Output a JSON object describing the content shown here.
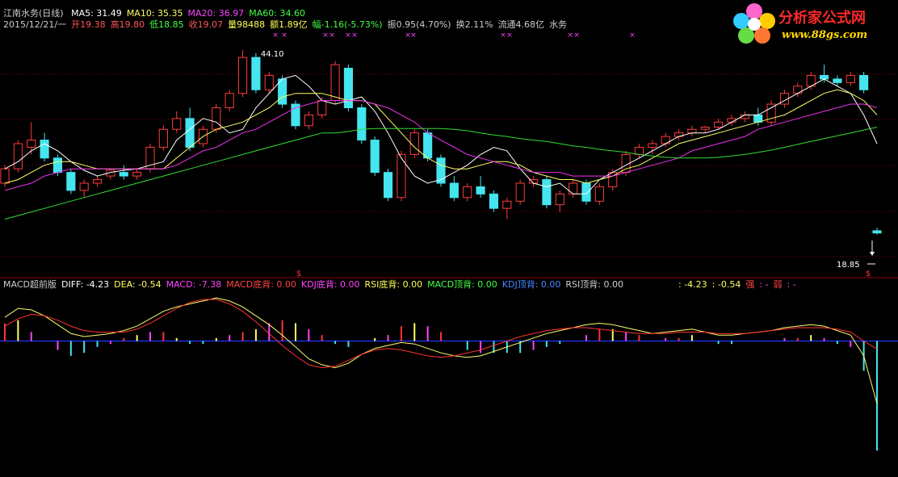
{
  "header": {
    "title": "江南水务(日线)",
    "ma": [
      {
        "label": "MA5: 31.49",
        "color": "#ffffff"
      },
      {
        "label": "MA10: 35.35",
        "color": "#ffff66"
      },
      {
        "label": "MA20: 36.97",
        "color": "#ff44ff"
      },
      {
        "label": "MA60: 34.60",
        "color": "#44ff44"
      }
    ],
    "info_line": [
      {
        "text": "2015/12/21/一",
        "color": "#cccccc"
      },
      {
        "text": "开19.38",
        "color": "#ff5555"
      },
      {
        "text": "高19.80",
        "color": "#ff5555"
      },
      {
        "text": "低18.85",
        "color": "#44ff44"
      },
      {
        "text": "收19.07",
        "color": "#ff5555"
      },
      {
        "text": "量98488",
        "color": "#ffff55"
      },
      {
        "text": "额1.89亿",
        "color": "#ffff55"
      },
      {
        "text": "幅-1.16(-5.73%)",
        "color": "#44ff44"
      },
      {
        "text": "振0.95(4.70%)",
        "color": "#cccccc"
      },
      {
        "text": "换2.11%",
        "color": "#cccccc"
      },
      {
        "text": "流通4.68亿",
        "color": "#cccccc"
      },
      {
        "text": "水务",
        "color": "#cccccc"
      }
    ],
    "macd_line": [
      {
        "text": "MACD超前版",
        "color": "#cccccc"
      },
      {
        "text": "DIFF: -4.23",
        "color": "#ffffff"
      },
      {
        "text": "DEA: -0.54",
        "color": "#ffff66"
      },
      {
        "text": "MACD: -7.38",
        "color": "#ff44ff"
      },
      {
        "text": "MACD底背: 0.00",
        "color": "#ff4444"
      },
      {
        "text": "KDJ底背: 0.00",
        "color": "#ff44ff"
      },
      {
        "text": "RSI底背: 0.00",
        "color": "#ffff55"
      },
      {
        "text": "MACD顶背: 0.00",
        "color": "#44ff44"
      },
      {
        "text": "KDJ顶背: 0.00",
        "color": "#4488ff"
      },
      {
        "text": "RSI顶背: 0.00",
        "color": "#cccccc"
      }
    ],
    "macd_right": [
      {
        "text": ": -4.23",
        "color": "#ffff66"
      },
      {
        "text": ": -0.54",
        "color": "#ffff66"
      },
      {
        "text": "强",
        "color": "#ff4444"
      },
      {
        "text": ": -",
        "color": "#ff44ff"
      },
      {
        "text": "弱",
        "color": "#ff4444"
      },
      {
        "text": ": -",
        "color": "#ff44ff"
      }
    ]
  },
  "logo": {
    "title": "分析家公式网",
    "url": "www.88gs.com"
  },
  "annotations": {
    "high_label": "44.10",
    "low_label": "18.85",
    "signal_label": "$"
  },
  "colors": {
    "up": "#ff3b3b",
    "down": "#44e5ee",
    "ma5": "#ffffff",
    "ma10": "#ffff66",
    "ma20": "#ee33ee",
    "ma60": "#33dd33",
    "diff": "#ffff66",
    "dea": "#ff3333",
    "zero": "#2233ff",
    "grid": "#8b0000",
    "mark": "#ff44ff"
  },
  "chart_data": [
    {
      "type": "candlestick",
      "title": "江南水务(日线)",
      "ylim": [
        17.8,
        47
      ],
      "series": [
        {
          "name": "MA5",
          "values": [
            28,
            29,
            30.5,
            31.5,
            30.5,
            29,
            27.8,
            27,
            27.5,
            27.8,
            28,
            28.5,
            29,
            32,
            33.5,
            35,
            34.5,
            33,
            33.5,
            36.5,
            38.5,
            40.5,
            41,
            39.5,
            37.5,
            37,
            37.5,
            38,
            36,
            33,
            29.5,
            27,
            26,
            26.5,
            27.5,
            28.5,
            30,
            31,
            30.5,
            28,
            26,
            25.5,
            26,
            24.5,
            24.5,
            26.5,
            27.5,
            28.5,
            29.5,
            30.5,
            31.5,
            32.5,
            33,
            33,
            33.5,
            34.5,
            35.5,
            35.5,
            36.5,
            37.5,
            38.5,
            39.5,
            40.5,
            39.5,
            38.5,
            35.5,
            31.5
          ]
        },
        {
          "name": "MA10",
          "values": [
            26,
            26.5,
            27.5,
            28.5,
            29,
            29,
            28.5,
            28,
            28,
            28,
            28,
            28,
            28,
            29.5,
            31,
            32.5,
            33.5,
            34,
            34.5,
            35.5,
            36.5,
            38,
            38.5,
            38.5,
            38.5,
            38,
            37.5,
            37.5,
            37,
            35,
            33,
            31,
            29.5,
            28.5,
            28,
            28,
            28.5,
            29,
            29,
            28.5,
            27.5,
            27,
            26.5,
            26.5,
            26,
            26.5,
            27,
            28,
            28.5,
            29.5,
            30.5,
            31.5,
            32,
            32.5,
            33,
            33.5,
            34,
            34.5,
            35,
            35.5,
            36.5,
            37.5,
            38.5,
            39,
            38.5,
            37.5,
            35.5
          ]
        },
        {
          "name": "MA20",
          "values": [
            25,
            25.5,
            26,
            27,
            27.5,
            28,
            28,
            28,
            28,
            28,
            28,
            28,
            28,
            28.5,
            29.5,
            30.5,
            31,
            32,
            33,
            33.5,
            34.5,
            35.5,
            36.5,
            37,
            37.5,
            37.5,
            37.5,
            37.5,
            37,
            36.5,
            35.5,
            34.5,
            33,
            32,
            31,
            30,
            29.5,
            29,
            28.5,
            28,
            27.5,
            27.5,
            27.5,
            27,
            27,
            27,
            27,
            27.5,
            28,
            28.5,
            29,
            29.5,
            30.5,
            31,
            31.5,
            32,
            32.5,
            33.5,
            34,
            34.5,
            35,
            35.5,
            36,
            36.5,
            37,
            37,
            36.5
          ]
        },
        {
          "name": "MA60",
          "values": [
            21,
            21.5,
            22,
            22.5,
            23,
            23.5,
            24,
            24.5,
            25,
            25.5,
            26,
            26.5,
            27,
            27.5,
            28,
            28.5,
            29,
            29.5,
            30,
            30.5,
            31,
            31.5,
            32,
            32.5,
            33,
            33,
            33.2,
            33.5,
            33.6,
            33.6,
            33.6,
            33.6,
            33.6,
            33.6,
            33.5,
            33.3,
            33,
            32.7,
            32.5,
            32.2,
            32,
            31.8,
            31.5,
            31.2,
            31,
            30.7,
            30.5,
            30.3,
            30,
            29.8,
            29.6,
            29.5,
            29.5,
            29.5,
            29.6,
            29.8,
            30,
            30.3,
            30.6,
            31,
            31.4,
            31.8,
            32.2,
            32.6,
            33,
            33.4,
            33.8
          ]
        }
      ],
      "candles": [
        {
          "o": 26,
          "h": 28.5,
          "l": 25.5,
          "c": 28
        },
        {
          "o": 28,
          "h": 32,
          "l": 27.5,
          "c": 31.5
        },
        {
          "o": 31,
          "h": 34.5,
          "l": 30,
          "c": 32
        },
        {
          "o": 32,
          "h": 33,
          "l": 29,
          "c": 29.5
        },
        {
          "o": 29.5,
          "h": 30,
          "l": 27,
          "c": 27.5
        },
        {
          "o": 27.5,
          "h": 28,
          "l": 24.5,
          "c": 25
        },
        {
          "o": 25,
          "h": 26.5,
          "l": 24,
          "c": 26
        },
        {
          "o": 26,
          "h": 27,
          "l": 25.5,
          "c": 26.5
        },
        {
          "o": 27,
          "h": 28,
          "l": 26.5,
          "c": 27.8
        },
        {
          "o": 27.5,
          "h": 28.5,
          "l": 26.5,
          "c": 27
        },
        {
          "o": 27,
          "h": 28,
          "l": 26.5,
          "c": 27.5
        },
        {
          "o": 28,
          "h": 31.5,
          "l": 27.5,
          "c": 31
        },
        {
          "o": 31,
          "h": 34,
          "l": 30.5,
          "c": 33.5
        },
        {
          "o": 33.5,
          "h": 36,
          "l": 33,
          "c": 35
        },
        {
          "o": 35,
          "h": 36.5,
          "l": 30.5,
          "c": 31
        },
        {
          "o": 31.5,
          "h": 34,
          "l": 31,
          "c": 33.5
        },
        {
          "o": 33.5,
          "h": 37,
          "l": 33,
          "c": 36.5
        },
        {
          "o": 36.5,
          "h": 39,
          "l": 36,
          "c": 38.5
        },
        {
          "o": 38.5,
          "h": 44.5,
          "l": 38,
          "c": 43.5
        },
        {
          "o": 43.5,
          "h": 44.1,
          "l": 38.5,
          "c": 39
        },
        {
          "o": 39,
          "h": 41.5,
          "l": 38.5,
          "c": 41
        },
        {
          "o": 40.5,
          "h": 41,
          "l": 36.5,
          "c": 37
        },
        {
          "o": 37,
          "h": 37.5,
          "l": 33.5,
          "c": 34
        },
        {
          "o": 34,
          "h": 36,
          "l": 33.5,
          "c": 35.5
        },
        {
          "o": 35.5,
          "h": 38,
          "l": 35,
          "c": 37.5
        },
        {
          "o": 37.5,
          "h": 43,
          "l": 37,
          "c": 42.5
        },
        {
          "o": 42,
          "h": 42.5,
          "l": 36,
          "c": 36.5
        },
        {
          "o": 36.5,
          "h": 37,
          "l": 31.5,
          "c": 32
        },
        {
          "o": 32,
          "h": 32.5,
          "l": 27,
          "c": 27.5
        },
        {
          "o": 27.5,
          "h": 28,
          "l": 23.5,
          "c": 24
        },
        {
          "o": 24,
          "h": 30.5,
          "l": 23.5,
          "c": 30
        },
        {
          "o": 30,
          "h": 33.5,
          "l": 29.5,
          "c": 33
        },
        {
          "o": 33,
          "h": 33.5,
          "l": 29,
          "c": 29.5
        },
        {
          "o": 29.5,
          "h": 30,
          "l": 25.5,
          "c": 26
        },
        {
          "o": 26,
          "h": 27,
          "l": 23.5,
          "c": 24
        },
        {
          "o": 24,
          "h": 26,
          "l": 23.5,
          "c": 25.5
        },
        {
          "o": 25.5,
          "h": 27,
          "l": 24,
          "c": 24.5
        },
        {
          "o": 24.5,
          "h": 25,
          "l": 22,
          "c": 22.5
        },
        {
          "o": 22.5,
          "h": 24,
          "l": 21,
          "c": 23.5
        },
        {
          "o": 23.5,
          "h": 26.5,
          "l": 23,
          "c": 26
        },
        {
          "o": 26,
          "h": 27,
          "l": 25.5,
          "c": 26.5
        },
        {
          "o": 26.5,
          "h": 27,
          "l": 22.5,
          "c": 23
        },
        {
          "o": 23,
          "h": 25,
          "l": 22,
          "c": 24.5
        },
        {
          "o": 24.5,
          "h": 26.5,
          "l": 24,
          "c": 26
        },
        {
          "o": 26,
          "h": 26.5,
          "l": 23,
          "c": 23.5
        },
        {
          "o": 23.5,
          "h": 26,
          "l": 23,
          "c": 25.5
        },
        {
          "o": 25.5,
          "h": 28,
          "l": 25,
          "c": 27.5
        },
        {
          "o": 27.5,
          "h": 30.5,
          "l": 27,
          "c": 30
        },
        {
          "o": 30,
          "h": 31.5,
          "l": 29.5,
          "c": 31
        },
        {
          "o": 31,
          "h": 32,
          "l": 30,
          "c": 31.5
        },
        {
          "o": 31.5,
          "h": 33,
          "l": 31,
          "c": 32.5
        },
        {
          "o": 32.5,
          "h": 33.5,
          "l": 32,
          "c": 33
        },
        {
          "o": 33,
          "h": 34,
          "l": 32.5,
          "c": 33.5
        },
        {
          "o": 33.5,
          "h": 34,
          "l": 33,
          "c": 33.8
        },
        {
          "o": 33.8,
          "h": 35,
          "l": 33.5,
          "c": 34.5
        },
        {
          "o": 34.5,
          "h": 35.5,
          "l": 34,
          "c": 35
        },
        {
          "o": 35,
          "h": 36,
          "l": 34.5,
          "c": 35.5
        },
        {
          "o": 35.5,
          "h": 36.5,
          "l": 34,
          "c": 34.5
        },
        {
          "o": 34.5,
          "h": 37.5,
          "l": 34,
          "c": 37
        },
        {
          "o": 37,
          "h": 39,
          "l": 36.5,
          "c": 38.5
        },
        {
          "o": 38.5,
          "h": 40,
          "l": 38,
          "c": 39.5
        },
        {
          "o": 39.5,
          "h": 41.5,
          "l": 39,
          "c": 41
        },
        {
          "o": 41,
          "h": 42.5,
          "l": 40,
          "c": 40.5
        },
        {
          "o": 40.5,
          "h": 41,
          "l": 39.5,
          "c": 40
        },
        {
          "o": 40,
          "h": 41.5,
          "l": 39.5,
          "c": 41
        },
        {
          "o": 41,
          "h": 41.5,
          "l": 38.5,
          "c": 39
        },
        {
          "o": 19.38,
          "h": 19.8,
          "l": 18.85,
          "c": 19.07
        }
      ],
      "high_label": {
        "index": 19,
        "value": 44.1
      },
      "low_label": {
        "index": 66,
        "value": 18.85
      }
    },
    {
      "type": "bar",
      "title": "MACD超前版",
      "ylim": [
        -9,
        3.4
      ],
      "series": [
        {
          "name": "DIFF",
          "values": [
            1.6,
            2.2,
            2.1,
            1.7,
            1.1,
            0.5,
            0.3,
            0.4,
            0.5,
            0.7,
            1.0,
            1.5,
            2.0,
            2.3,
            2.5,
            2.7,
            2.9,
            2.7,
            2.3,
            1.7,
            1.1,
            0.4,
            -0.4,
            -1.2,
            -1.6,
            -1.8,
            -1.5,
            -0.9,
            -0.5,
            -0.3,
            -0.1,
            -0.2,
            -0.5,
            -0.8,
            -1.0,
            -1.1,
            -1.0,
            -0.7,
            -0.4,
            -0.1,
            0.2,
            0.5,
            0.7,
            0.9,
            1.1,
            1.2,
            1.1,
            0.9,
            0.7,
            0.5,
            0.6,
            0.7,
            0.8,
            0.6,
            0.4,
            0.4,
            0.5,
            0.6,
            0.7,
            0.9,
            1.0,
            1.1,
            1.0,
            0.7,
            0.4,
            -1.0,
            -4.23
          ]
        },
        {
          "name": "DEA",
          "values": [
            1.0,
            1.5,
            1.8,
            1.7,
            1.4,
            1.0,
            0.7,
            0.6,
            0.6,
            0.6,
            0.8,
            1.2,
            1.7,
            2.2,
            2.6,
            2.8,
            2.8,
            2.5,
            2.0,
            1.3,
            0.5,
            -0.3,
            -1.0,
            -1.6,
            -1.8,
            -1.7,
            -1.3,
            -0.9,
            -0.6,
            -0.5,
            -0.6,
            -0.8,
            -1.0,
            -1.1,
            -1.0,
            -0.8,
            -0.6,
            -0.3,
            0.0,
            0.3,
            0.5,
            0.7,
            0.8,
            0.9,
            0.9,
            0.8,
            0.7,
            0.6,
            0.5,
            0.5,
            0.5,
            0.6,
            0.6,
            0.6,
            0.5,
            0.5,
            0.5,
            0.6,
            0.7,
            0.8,
            0.9,
            0.9,
            0.9,
            0.8,
            0.6,
            0.0,
            -0.54
          ]
        },
        {
          "name": "MACD",
          "values": [
            1.2,
            1.4,
            0.6,
            0.0,
            -0.6,
            -1.0,
            -0.8,
            -0.4,
            -0.2,
            0.2,
            0.4,
            0.6,
            0.6,
            0.2,
            -0.2,
            -0.2,
            0.2,
            0.4,
            0.6,
            0.8,
            1.2,
            1.4,
            1.2,
            0.8,
            0.4,
            -0.2,
            -0.4,
            0.0,
            0.2,
            0.4,
            1.0,
            1.2,
            1.0,
            0.6,
            0.0,
            -0.6,
            -0.8,
            -0.8,
            -0.8,
            -0.8,
            -0.6,
            -0.4,
            -0.2,
            0.0,
            0.4,
            0.8,
            0.8,
            0.6,
            0.4,
            0.0,
            0.2,
            0.2,
            0.4,
            0.0,
            -0.2,
            -0.2,
            0.0,
            0.0,
            0.0,
            0.2,
            0.2,
            0.4,
            0.2,
            -0.2,
            -0.4,
            -2.0,
            -7.38
          ]
        }
      ]
    }
  ]
}
